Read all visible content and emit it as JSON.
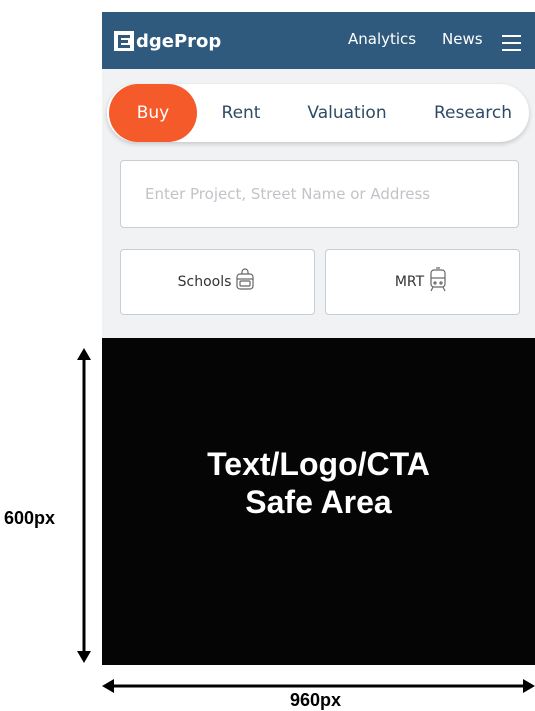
{
  "header": {
    "logo_mark": "E",
    "logo_text": "dgeProp",
    "nav_analytics": "Analytics",
    "nav_news": "News",
    "menu_icon": "hamburger-menu-icon",
    "background": "#2f5a7e"
  },
  "tabs": [
    {
      "label": "Buy",
      "active": true
    },
    {
      "label": "Rent",
      "active": false
    },
    {
      "label": "Valuation",
      "active": false
    },
    {
      "label": "Research",
      "active": false
    }
  ],
  "search": {
    "placeholder": "Enter Project, Street Name or Address",
    "value": ""
  },
  "quick_filters": {
    "schools_label": "Schools",
    "schools_icon": "backpack-icon",
    "mrt_label": "MRT",
    "mrt_icon": "train-icon"
  },
  "ad_area": {
    "line1": "Text/Logo/CTA",
    "line2": "Safe Area",
    "background": "#050505"
  },
  "dimensions": {
    "height_label": "600px",
    "width_label": "960px"
  },
  "colors": {
    "accent": "#f45a2a",
    "header": "#2f5a7e"
  }
}
